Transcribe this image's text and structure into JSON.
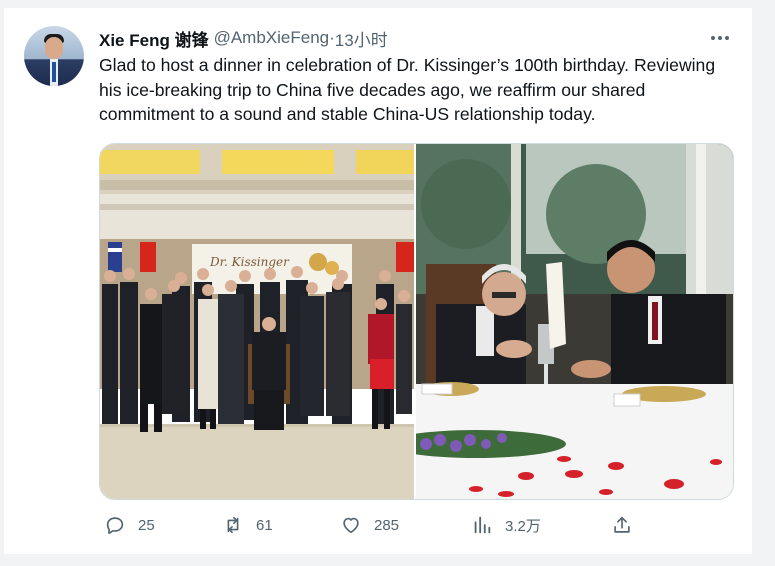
{
  "tweet": {
    "author_name": "Xie Feng 谢锋",
    "handle": "@AmbXieFeng",
    "separator": " · ",
    "time": "13小时",
    "text": "Glad to host a dinner in celebration of Dr. Kissinger’s 100th birthday. Reviewing his ice-breaking trip to China five decades ago, we reaffirm our shared commitment to a sound and stable China-US relationship today.",
    "banner_text": "Dr. Kissinger"
  },
  "actions": {
    "replies": "25",
    "retweets": "61",
    "likes": "285",
    "views": "3.2万"
  },
  "icons": [
    "more-icon",
    "reply-icon",
    "retweet-icon",
    "like-icon",
    "views-icon",
    "share-icon"
  ],
  "colors": {
    "text": "#0f1419",
    "secondary": "#536471",
    "border": "#cfd9de"
  }
}
